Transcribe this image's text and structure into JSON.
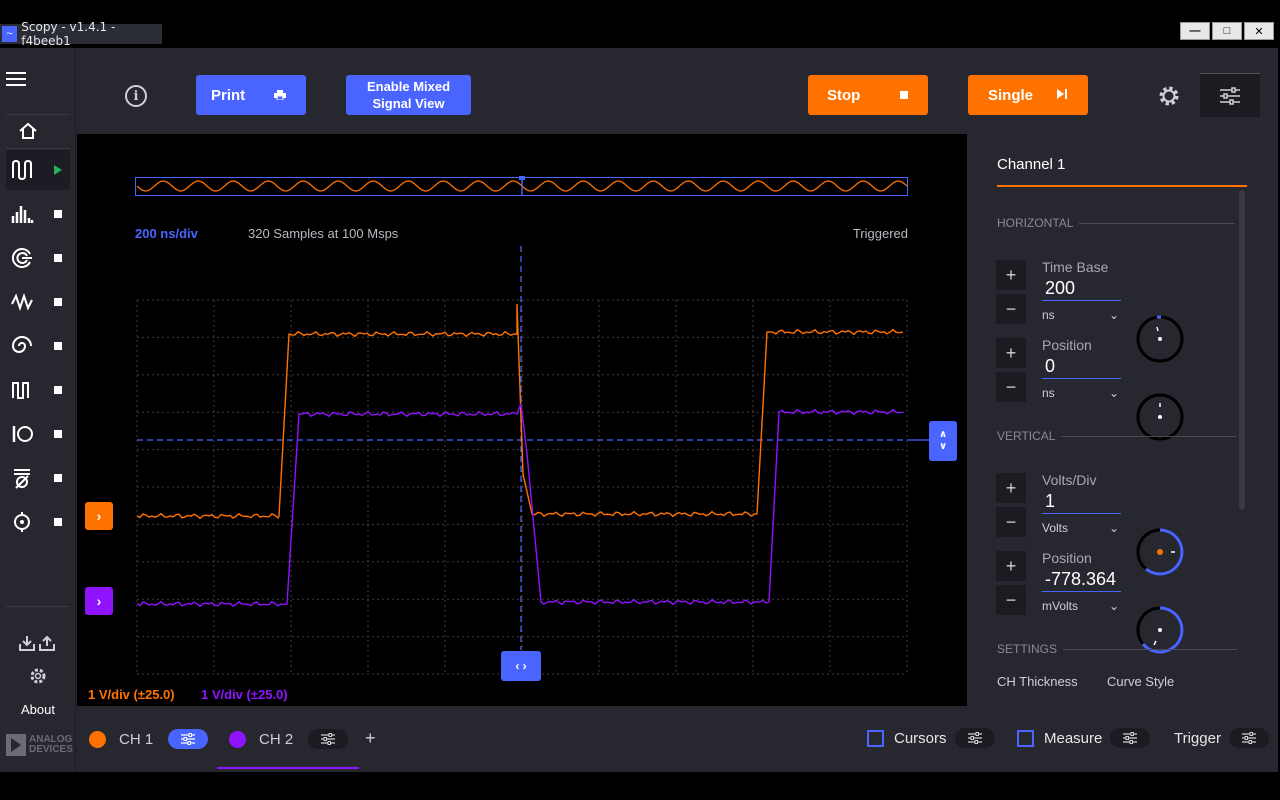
{
  "window": {
    "title": "Scopy - v1.4.1 - f4beeb1",
    "buttons": [
      "—",
      "□",
      "✕"
    ]
  },
  "sidebar": {
    "tools": [
      {
        "icon": "oscilloscope-icon",
        "status": "running"
      },
      {
        "icon": "spectrum-analyzer-icon",
        "status": "stopped"
      },
      {
        "icon": "network-analyzer-icon",
        "status": "stopped"
      },
      {
        "icon": "signal-generator-icon",
        "status": "stopped"
      },
      {
        "icon": "logic-analyzer-icon",
        "status": "stopped"
      },
      {
        "icon": "pattern-generator-icon",
        "status": "stopped"
      },
      {
        "icon": "digital-io-icon",
        "status": "stopped"
      },
      {
        "icon": "voltmeter-icon",
        "status": "stopped"
      },
      {
        "icon": "power-supply-icon",
        "status": "stopped"
      }
    ],
    "about_label": "About",
    "logo_text_1": "ANALOG",
    "logo_text_2": "DEVICES"
  },
  "toolbar": {
    "print_label": "Print",
    "mixed_label_1": "Enable Mixed",
    "mixed_label_2": "Signal View",
    "stop_label": "Stop",
    "single_label": "Single"
  },
  "plot": {
    "time_div": "200 ns/div",
    "samples": "320  Samples at 100 Msps",
    "status": "Triggered",
    "ch1_scale": "1 V/div (±25.0)",
    "ch2_scale": "1 V/div (±25.0)"
  },
  "colors": {
    "ch1": "#ff7200",
    "ch2": "#9013fe",
    "accent": "#4a64ff",
    "panel": "#272730"
  },
  "right_panel": {
    "title": "Channel 1",
    "horizontal_label": "HORIZONTAL",
    "time_base_label": "Time Base",
    "time_base_value": "200",
    "time_base_unit": "ns",
    "h_position_label": "Position",
    "h_position_value": "0",
    "h_position_unit": "ns",
    "vertical_label": "VERTICAL",
    "volts_div_label": "Volts/Div",
    "volts_div_value": "1",
    "volts_div_unit": "Volts",
    "v_position_label": "Position",
    "v_position_value": "-778.364",
    "v_position_unit": "mVolts",
    "settings_label": "SETTINGS",
    "ch_thickness_label": "CH Thickness",
    "curve_style_label": "Curve Style"
  },
  "bottombar": {
    "ch1_label": "CH 1",
    "ch2_label": "CH 2",
    "add_label": "+",
    "cursors_label": "Cursors",
    "measure_label": "Measure",
    "trigger_label": "Trigger"
  }
}
